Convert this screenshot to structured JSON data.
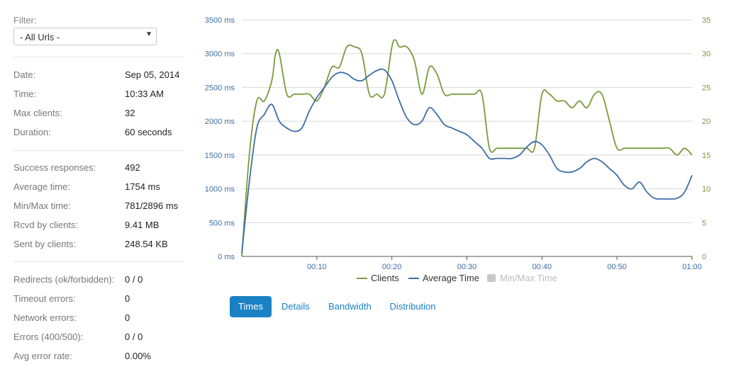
{
  "filter": {
    "label": "Filter:",
    "selected": "- All Urls -"
  },
  "stats": [
    {
      "key": "Date:",
      "value": "Sep 05, 2014"
    },
    {
      "key": "Time:",
      "value": "10:33 AM"
    },
    {
      "key": "Max clients:",
      "value": "32"
    },
    {
      "key": "Duration:",
      "value": "60 seconds"
    },
    {
      "key": "Success responses:",
      "value": "492"
    },
    {
      "key": "Average time:",
      "value": "1754 ms"
    },
    {
      "key": "Min/Max time:",
      "value": "781/2896 ms"
    },
    {
      "key": "Rcvd by clients:",
      "value": "9.41 MB"
    },
    {
      "key": "Sent by clients:",
      "value": "248.54 KB"
    },
    {
      "key": "Redirects (ok/forbidden):",
      "value": "0 / 0"
    },
    {
      "key": "Timeout errors:",
      "value": "0"
    },
    {
      "key": "Network errors:",
      "value": "0"
    },
    {
      "key": "Errors (400/500):",
      "value": "0 / 0"
    },
    {
      "key": "Avg error rate:",
      "value": "0.00%"
    }
  ],
  "tabs": [
    {
      "label": "Times",
      "active": true
    },
    {
      "label": "Details",
      "active": false
    },
    {
      "label": "Bandwidth",
      "active": false
    },
    {
      "label": "Distribution",
      "active": false
    }
  ],
  "chart_data": {
    "type": "line",
    "xlim": [
      0,
      60
    ],
    "x_ticks": [
      "00:10",
      "00:20",
      "00:30",
      "00:40",
      "00:50",
      "01:00"
    ],
    "left_axis": {
      "ylim": [
        0,
        3500
      ],
      "ticks": [
        "0 ms",
        "500 ms",
        "1000 ms",
        "1500 ms",
        "2000 ms",
        "2500 ms",
        "3000 ms",
        "3500 ms"
      ]
    },
    "right_axis": {
      "ylim": [
        0,
        35
      ],
      "ticks": [
        "0",
        "5",
        "10",
        "15",
        "20",
        "25",
        "30",
        "35"
      ]
    },
    "grid": true,
    "legend_position": "bottom",
    "series": [
      {
        "name": "Clients",
        "axis": "right",
        "color": "#7a9a3c",
        "x": [
          0,
          1,
          2,
          3,
          4,
          4.5,
          5,
          6,
          7,
          8,
          9,
          10,
          11,
          12,
          13,
          14,
          15,
          16,
          17,
          18,
          19,
          20,
          20.5,
          21,
          22,
          23,
          24,
          25,
          26,
          27,
          28,
          29,
          30,
          31,
          32,
          33,
          34,
          35,
          36,
          37,
          38,
          39,
          40,
          41,
          42,
          43,
          44,
          45,
          46,
          47,
          48,
          49,
          50,
          51,
          52,
          53,
          54,
          55,
          56,
          57,
          58,
          59,
          60
        ],
        "y": [
          0,
          15,
          23,
          23,
          26,
          30,
          30,
          24,
          24,
          24,
          24,
          23,
          25,
          28,
          28,
          31,
          31,
          30,
          24,
          24,
          24,
          31,
          32,
          31,
          31,
          29,
          24,
          28,
          27,
          24,
          24,
          24,
          24,
          24,
          24,
          16,
          16,
          16,
          16,
          16,
          16,
          16,
          24,
          24,
          23,
          23,
          22,
          23,
          22,
          24,
          24,
          20,
          16,
          16,
          16,
          16,
          16,
          16,
          16,
          16,
          15,
          16,
          15
        ]
      },
      {
        "name": "Average Time",
        "axis": "left",
        "color": "#3d6ea5",
        "x": [
          0,
          1,
          2,
          3,
          4,
          5,
          6,
          7,
          8,
          9,
          10,
          11,
          12,
          13,
          14,
          15,
          16,
          17,
          18,
          19,
          20,
          21,
          22,
          23,
          24,
          25,
          26,
          27,
          28,
          29,
          30,
          31,
          32,
          33,
          34,
          35,
          36,
          37,
          38,
          39,
          40,
          41,
          42,
          43,
          44,
          45,
          46,
          47,
          48,
          49,
          50,
          51,
          52,
          53,
          54,
          55,
          56,
          57,
          58,
          59,
          60
        ],
        "y": [
          50,
          1100,
          1900,
          2100,
          2250,
          2000,
          1900,
          1850,
          1900,
          2150,
          2350,
          2500,
          2650,
          2720,
          2700,
          2620,
          2600,
          2680,
          2750,
          2760,
          2600,
          2300,
          2050,
          1950,
          2000,
          2200,
          2100,
          1950,
          1900,
          1850,
          1800,
          1700,
          1600,
          1450,
          1450,
          1450,
          1450,
          1500,
          1620,
          1700,
          1650,
          1500,
          1300,
          1250,
          1250,
          1300,
          1400,
          1450,
          1400,
          1300,
          1200,
          1050,
          1000,
          1100,
          950,
          860,
          850,
          850,
          860,
          950,
          1200
        ]
      },
      {
        "name": "Min/Max Time",
        "axis": "left",
        "color": "#c8c8c8",
        "disabled": true
      }
    ]
  }
}
